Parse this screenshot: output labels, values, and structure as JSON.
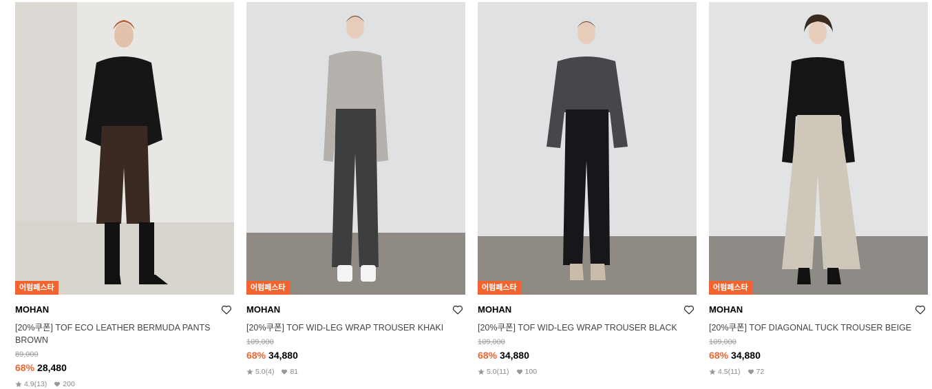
{
  "products": [
    {
      "badge": "어텀페스타",
      "brand": "MOHAN",
      "title": "[20%쿠폰] TOF ECO LEATHER BERMUDA PANTS BROWN",
      "original_price": "89,000",
      "discount": "68%",
      "price": "28,480",
      "rating": "4.9",
      "reviews": "(13)",
      "likes": "200",
      "image": "model wearing black cardigan and brown leather bermuda pants with black boots"
    },
    {
      "badge": "어텀페스타",
      "brand": "MOHAN",
      "title": "[20%쿠폰] TOF WID-LEG WRAP TROUSER KHAKI",
      "original_price": "109,000",
      "discount": "68%",
      "price": "34,880",
      "rating": "5.0",
      "reviews": "(4)",
      "likes": "81",
      "image": "model wearing light grey turtleneck and dark khaki wide-leg trousers with white shoes"
    },
    {
      "badge": "어텀페스타",
      "brand": "MOHAN",
      "title": "[20%쿠폰] TOF WID-LEG WRAP TROUSER BLACK",
      "original_price": "109,000",
      "discount": "68%",
      "price": "34,880",
      "rating": "5.0",
      "reviews": "(11)",
      "likes": "100",
      "image": "model wearing charcoal draped top and black wide-leg trousers with beige shoes"
    },
    {
      "badge": "어텀페스타",
      "brand": "MOHAN",
      "title": "[20%쿠폰] TOF DIAGONAL TUCK TROUSER BEIGE",
      "original_price": "109,000",
      "discount": "68%",
      "price": "34,880",
      "rating": "4.5",
      "reviews": "(11)",
      "likes": "72",
      "image": "model wearing black long-sleeve top and beige wide trousers with black shoes"
    }
  ],
  "colors": {
    "accent": "#f2642d",
    "title_text": "#444444",
    "muted_text": "#999999"
  },
  "icons": [
    "heart-outline-icon",
    "star-icon",
    "heart-filled-icon"
  ]
}
